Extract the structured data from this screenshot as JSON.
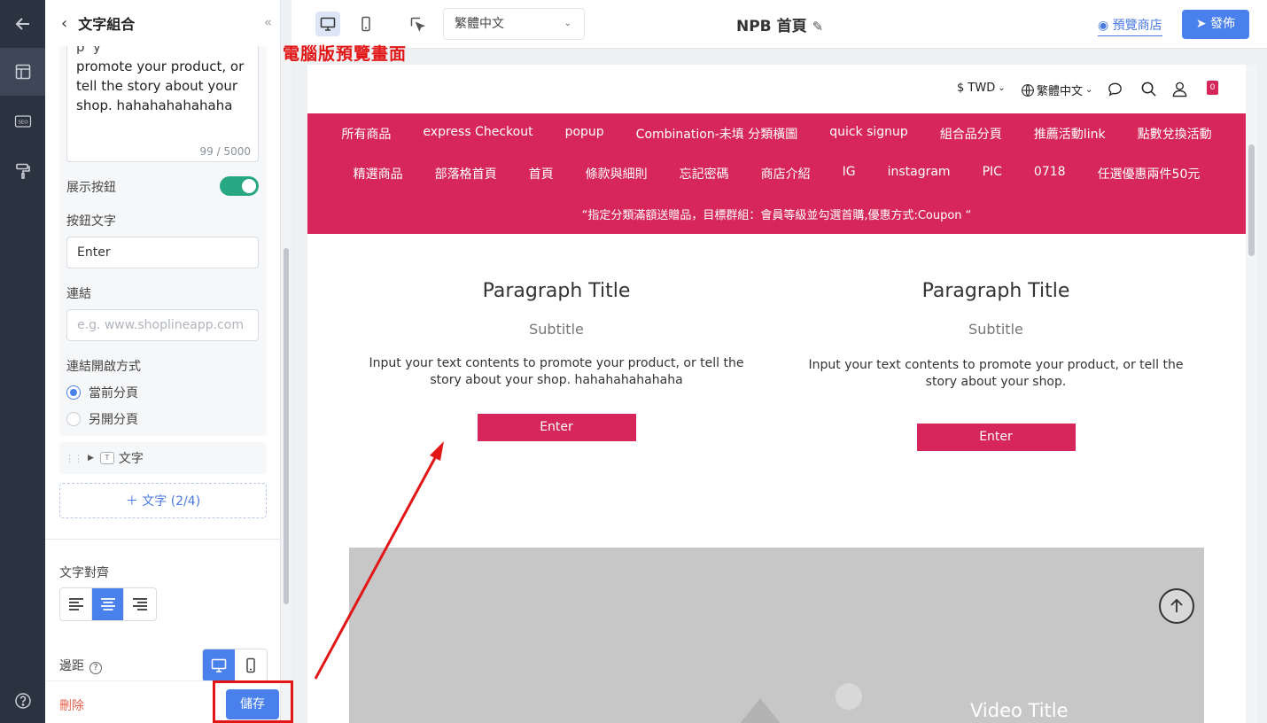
{
  "panel": {
    "title": "文字組合",
    "textarea_value": "promote your product, or tell the story about your shop. hahahahahahaha",
    "char_count": "99 / 5000",
    "show_button_label": "展示按鈕",
    "show_button_on": true,
    "button_text_label": "按鈕文字",
    "button_text_value": "Enter",
    "link_label": "連結",
    "link_placeholder": "e.g. www.shoplineapp.com",
    "open_mode_label": "連結開啟方式",
    "open_current": "當前分頁",
    "open_new": "另開分頁",
    "text_item": "文字",
    "add_text": "＋ 文字 (2/4)",
    "align_label": "文字對齊",
    "margin_label": "邊距",
    "delete": "刪除",
    "save": "儲存"
  },
  "topbar": {
    "language": "繁體中文",
    "page_title": "NPB 首頁",
    "preview_store": "預覽商店",
    "publish": "發佈"
  },
  "annotation": {
    "label": "電腦版預覽畫面",
    "color": "#e21616"
  },
  "store": {
    "currency": "$ TWD",
    "language": "繁體中文",
    "cart_count": "0",
    "nav_row1": [
      "所有商品",
      "express Checkout",
      "popup",
      "Combination-未填 分類橫圖",
      "quick signup",
      "組合品分頁",
      "推薦活動link",
      "點數兌換活動"
    ],
    "nav_row2": [
      "精選商品",
      "部落格首頁",
      "首頁",
      "條款與細則",
      "忘記密碼",
      "商店介紹",
      "IG",
      "instagram",
      "PIC",
      "0718",
      "任選優惠兩件50元"
    ],
    "promo": "“指定分類滿額送贈品，目標群組：會員等級並勾選首購,優惠方式:Coupon “",
    "col1": {
      "title": "Paragraph Title",
      "subtitle": "Subtitle",
      "body": "Input your text contents to promote your product, or tell the story about your shop. hahahahahahaha",
      "button": "Enter"
    },
    "col2": {
      "title": "Paragraph Title",
      "subtitle": "Subtitle",
      "body": "Input your text contents to promote your product, or tell the story about your shop.",
      "button": "Enter"
    },
    "video_title": "Video Title"
  },
  "colors": {
    "brand": "#d7265a",
    "accent": "#4a80ec",
    "toggle": "#27a882"
  }
}
